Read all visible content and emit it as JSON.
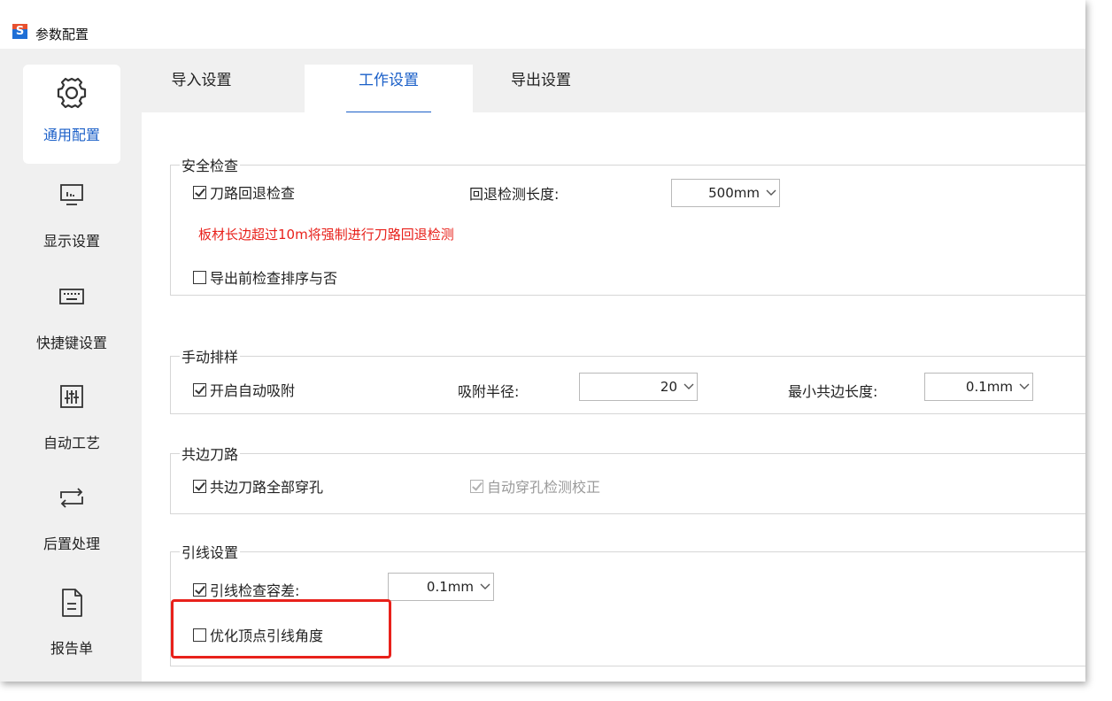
{
  "window": {
    "title": "参数配置"
  },
  "sidebar": {
    "items": [
      {
        "label": "通用配置",
        "icon": "gear-icon",
        "active": true
      },
      {
        "label": "显示设置",
        "icon": "monitor-icon"
      },
      {
        "label": "快捷键设置",
        "icon": "keyboard-icon"
      },
      {
        "label": "自动工艺",
        "icon": "sliders-icon"
      },
      {
        "label": "后置处理",
        "icon": "loop-arrows-icon"
      },
      {
        "label": "报告单",
        "icon": "document-icon"
      }
    ]
  },
  "tabs": [
    {
      "label": "导入设置"
    },
    {
      "label": "工作设置",
      "active": true
    },
    {
      "label": "导出设置"
    }
  ],
  "groups": {
    "safety": {
      "title": "安全检查",
      "toolpath_check": {
        "label": "刀路回退检查",
        "checked": true
      },
      "backoff_length_label": "回退检测长度:",
      "backoff_length_value": "500mm",
      "warning": "板材长边超过10m将强制进行刀路回退检测",
      "sort_check": {
        "label": "导出前检查排序与否",
        "checked": false
      }
    },
    "manual_nesting": {
      "title": "手动排样",
      "auto_snap": {
        "label": "开启自动吸附",
        "checked": true
      },
      "snap_radius_label": "吸附半径:",
      "snap_radius_value": "20",
      "min_common_edge_label": "最小共边长度:",
      "min_common_edge_value": "0.1mm"
    },
    "common_edge": {
      "title": "共边刀路",
      "pierce_all": {
        "label": "共边刀路全部穿孔",
        "checked": true
      },
      "auto_pierce_correct": {
        "label": "自动穿孔检测校正",
        "checked": true,
        "disabled": true
      }
    },
    "lead": {
      "title": "引线设置",
      "tolerance": {
        "label": "引线检查容差:",
        "checked": true
      },
      "tolerance_value": "0.1mm",
      "optimize_angle": {
        "label": "优化顶点引线角度",
        "checked": false
      }
    }
  },
  "colors": {
    "accent": "#1a5fc8",
    "warning": "#e8211b",
    "highlight": "#e8211b"
  }
}
